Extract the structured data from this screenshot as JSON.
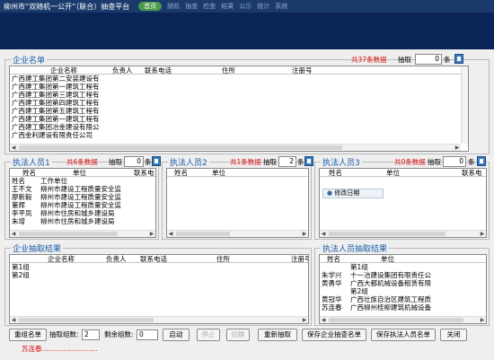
{
  "window": {
    "title": "柳州市“双随机一公开”（联合）抽查平台",
    "tabs": [
      "首页",
      "随机",
      "抽查",
      "检查",
      "结果",
      "公示",
      "统计",
      "系统"
    ]
  },
  "enterprise": {
    "title": "企业名单",
    "count": "共37条数据",
    "pick_label": "抽取",
    "pick_value": "0",
    "unit": "条",
    "columns": [
      "企业名称",
      "负责人",
      "联系电话",
      "住所",
      "注册号",
      "统"
    ],
    "rows": [
      "广西建工集团第二安装建设有",
      "广西建工集团第一建筑工程有",
      "广西建工集团第三建筑工程有",
      "广西建工集团第四建筑工程有",
      "广西建工集团第五建筑工程有",
      "广西建工集团第一建筑工程有",
      "广西建工集团冶金建设有限公",
      "广西金利建设有限责任公司"
    ]
  },
  "staff1": {
    "title": "执法人员1",
    "count": "共6条数据",
    "pick_label": "抽取",
    "pick_value": "0",
    "unit": "条",
    "columns": [
      "姓名",
      "单位",
      "联系电"
    ],
    "rows": [
      {
        "name": "姓名",
        "unit": "工作单位"
      },
      {
        "name": "王不文",
        "unit": "柳州市建设工程质量安全监"
      },
      {
        "name": "廖新毅",
        "unit": "柳州市建设工程质量安全监"
      },
      {
        "name": "董辉",
        "unit": "柳州市建设工程质量安全监"
      },
      {
        "name": "李平凤",
        "unit": "柳州市住房和城乡建设局"
      },
      {
        "name": "朱增",
        "unit": "柳州市住房和城乡建设局"
      }
    ]
  },
  "staff2": {
    "title": "执法人员2",
    "count": "共1条数据",
    "pick_label": "抽取",
    "pick_value": "2",
    "unit": "条",
    "columns": [
      "姓名",
      "单位"
    ]
  },
  "staff3": {
    "title": "执法人员3",
    "count": "共0条数据",
    "pick_label": "抽取",
    "pick_value": "0",
    "unit": "条",
    "columns": [
      "姓名",
      "单位",
      "联系电"
    ],
    "popup_item": "修改日期"
  },
  "ent_result": {
    "title": "企业抽取结果",
    "columns": [
      "企业名称",
      "负责人",
      "联系电话",
      "住所",
      "注册号"
    ],
    "rows": [
      "第1组",
      "第2组"
    ]
  },
  "staff_result": {
    "title": "执法人员抽取结果",
    "columns": [
      "姓名",
      "单位"
    ],
    "rows": [
      {
        "name": "",
        "unit": "第1组"
      },
      {
        "name": "朱学兴",
        "unit": "十一冶建设集团有限责任公"
      },
      {
        "name": "黄勇华",
        "unit": "广西大都机械设备租赁有限"
      },
      {
        "name": "",
        "unit": "第2组"
      },
      {
        "name": "黄冠华",
        "unit": "广西壮族自治区建筑工程质"
      },
      {
        "name": "苏连春",
        "unit": "广西柳州桂柳建筑机械设备"
      }
    ]
  },
  "bottom": {
    "regroup": "重组名单",
    "groups_label": "抽取组数:",
    "groups_value": "2",
    "remain_label": "剩余组数:",
    "remain_value": "0",
    "start": "启动",
    "stop": "停止",
    "switch": "切换",
    "redraw": "重新抽取",
    "save_ent": "保存企业抽查名单",
    "save_staff": "保存执法人员名单",
    "close": "关闭",
    "operator": "苏连春.........................."
  }
}
